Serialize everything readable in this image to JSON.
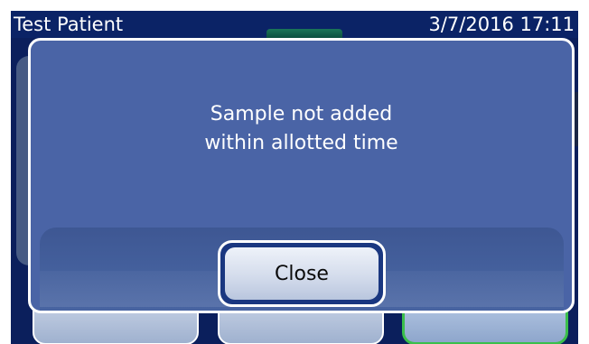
{
  "header": {
    "patient_name": "Test Patient",
    "datetime": "3/7/2016 17:11"
  },
  "dialog": {
    "message_line1": "Sample not added",
    "message_line2": "within allotted time",
    "close_label": "Close"
  },
  "colors": {
    "screen_bg": "#0b1f5c",
    "dialog_bg": "#4a64a6",
    "accent_green": "#3bbf4b"
  }
}
